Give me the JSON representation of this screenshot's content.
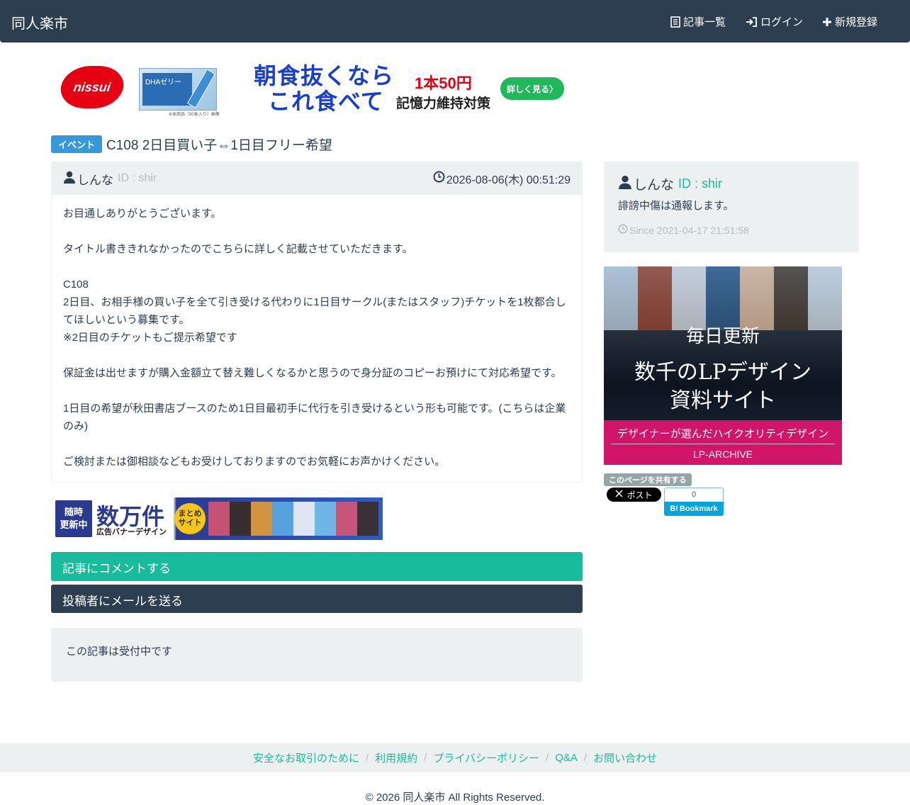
{
  "navbar": {
    "brand": "同人楽市",
    "articles": "記事一覧",
    "login": "ログイン",
    "register": "新規登録"
  },
  "ad_top": {
    "logo": "nissui",
    "product_label": "DHAゼリー",
    "product_note": "※本商品（30本入り）画像",
    "copy_line1": "朝食抜くなら",
    "copy_line2": "これ食べて",
    "price": "1本50円",
    "sub": "記憶力維持対策",
    "button": "詳しく見る〉"
  },
  "post": {
    "category": "イベント",
    "title": "C108 2日目買い子⇔1日目フリー希望",
    "author": "しんな",
    "author_id": "ID : shir",
    "datetime": "2026-08-06(木) 00:51:29",
    "body": [
      "お目通しありがとうございます。",
      "",
      "タイトル書ききれなかったのでこちらに詳しく記載させていただきます。",
      "",
      "C108",
      "2日目、お相手様の買い子を全て引き受ける代わりに1日目サークル(またはスタッフ)チケットを1枚都合し",
      "てほしいという募集です。",
      "※2日目のチケットもご提示希望です",
      "",
      "保証金は出せますが購入金額立て替え難しくなるかと思うので身分証のコピーお預けにて対応希望です。",
      "",
      "1日目の希望が秋田書店ブースのため1日目最初手に代行を引き受けるという形も可能です。(こちらは企業",
      "のみ)",
      "",
      "ご検討または御相談などもお受けしておりますのでお気軽にお声かけください。"
    ]
  },
  "ad_mid": {
    "badge": "随時\n更新中",
    "big": "数万件",
    "small": "広告バナーデザイン",
    "circle": "まとめ\nサイト"
  },
  "actions": {
    "comment": "記事にコメントする",
    "mail": "投稿者にメールを送る"
  },
  "status": "この記事は受付中です",
  "profile": {
    "name": "しんな",
    "id": "ID : shir",
    "bio": "誹謗中傷は通報します。",
    "since": "Since 2021-04-17 21:51:58"
  },
  "ad_side": {
    "line1": "毎日更新",
    "line2": "数千のLPデザイン",
    "line3": "資料サイト",
    "band_text": "デザイナーが選んだハイクオリティデザイン",
    "band_brand": "LP-ARCHIVE"
  },
  "share": {
    "label": "このページを共有する",
    "x_post": "ポスト",
    "hatena_count": "0",
    "hatena_label": "Bookmark"
  },
  "footer": {
    "links": [
      "安全なお取引のために",
      "利用規約",
      "プライバシーポリシー",
      "Q&A",
      "お問い合わせ"
    ],
    "copyright": "© 2026 同人楽市 All Rights Reserved."
  },
  "colors": {
    "navbar": "#2c3e50",
    "accent": "#18bc9c",
    "badge": "#3498db",
    "muted": "#b4bcc2",
    "well": "#ecf0f1"
  }
}
